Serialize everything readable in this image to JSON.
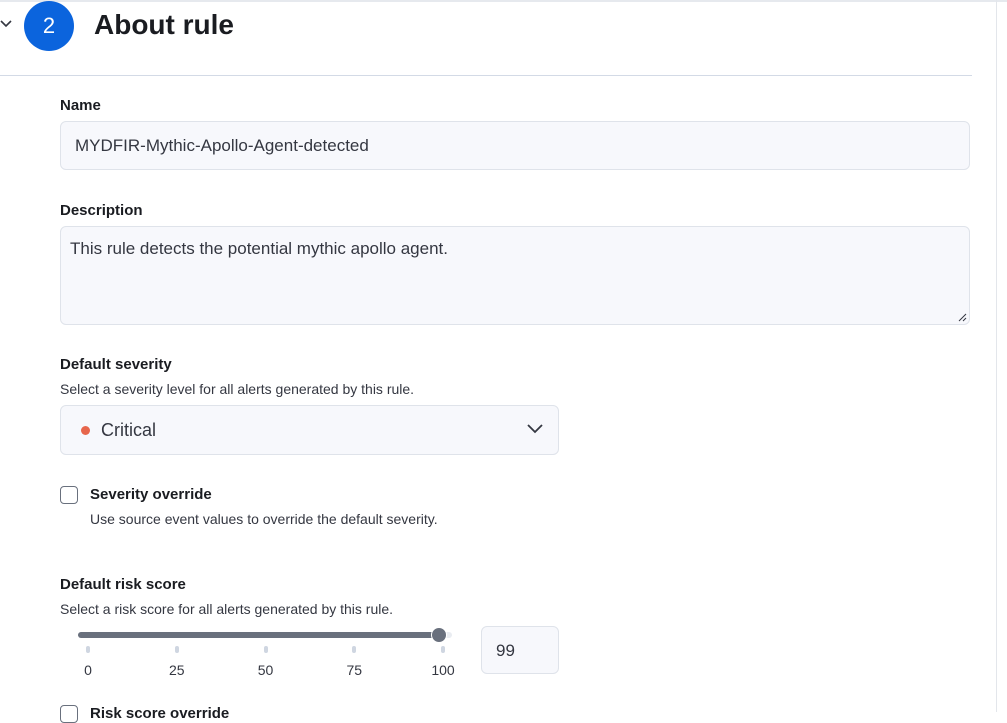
{
  "header": {
    "step_number": "2",
    "title": "About rule"
  },
  "name_field": {
    "label": "Name",
    "value": "MYDFIR-Mythic-Apollo-Agent-detected"
  },
  "description_field": {
    "label": "Description",
    "value": "This rule detects the potential mythic apollo agent."
  },
  "severity": {
    "label": "Default severity",
    "help": "Select a severity level for all alerts generated by this rule.",
    "selected": "Critical",
    "selected_color": "#e7664c"
  },
  "severity_override": {
    "label": "Severity override",
    "help": "Use source event values to override the default severity.",
    "checked": false
  },
  "risk_score": {
    "label": "Default risk score",
    "help": "Select a risk score for all alerts generated by this rule.",
    "value": 99,
    "value_text": "99",
    "ticks": [
      "0",
      "25",
      "50",
      "75",
      "100"
    ]
  },
  "risk_score_override": {
    "label": "Risk score override"
  },
  "colors": {
    "accent": "#0b64dd",
    "slider": "#69707d"
  }
}
